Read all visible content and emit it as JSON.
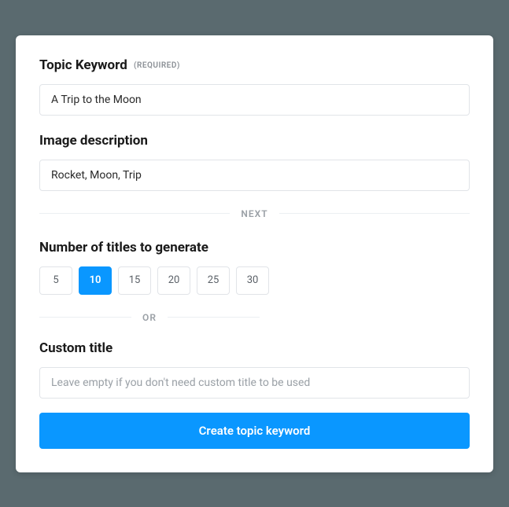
{
  "topic_keyword": {
    "label": "Topic Keyword",
    "required_tag": "(REQUIRED)",
    "value": "A Trip to the Moon"
  },
  "image_description": {
    "label": "Image description",
    "value": "Rocket, Moon, Trip"
  },
  "divider_next": "NEXT",
  "titles_count": {
    "label": "Number of titles to generate",
    "options": [
      "5",
      "10",
      "15",
      "20",
      "25",
      "30"
    ],
    "selected": "10"
  },
  "divider_or": "OR",
  "custom_title": {
    "label": "Custom title",
    "placeholder": "Leave empty if you don't need custom title to be used",
    "value": ""
  },
  "submit_label": "Create topic keyword"
}
